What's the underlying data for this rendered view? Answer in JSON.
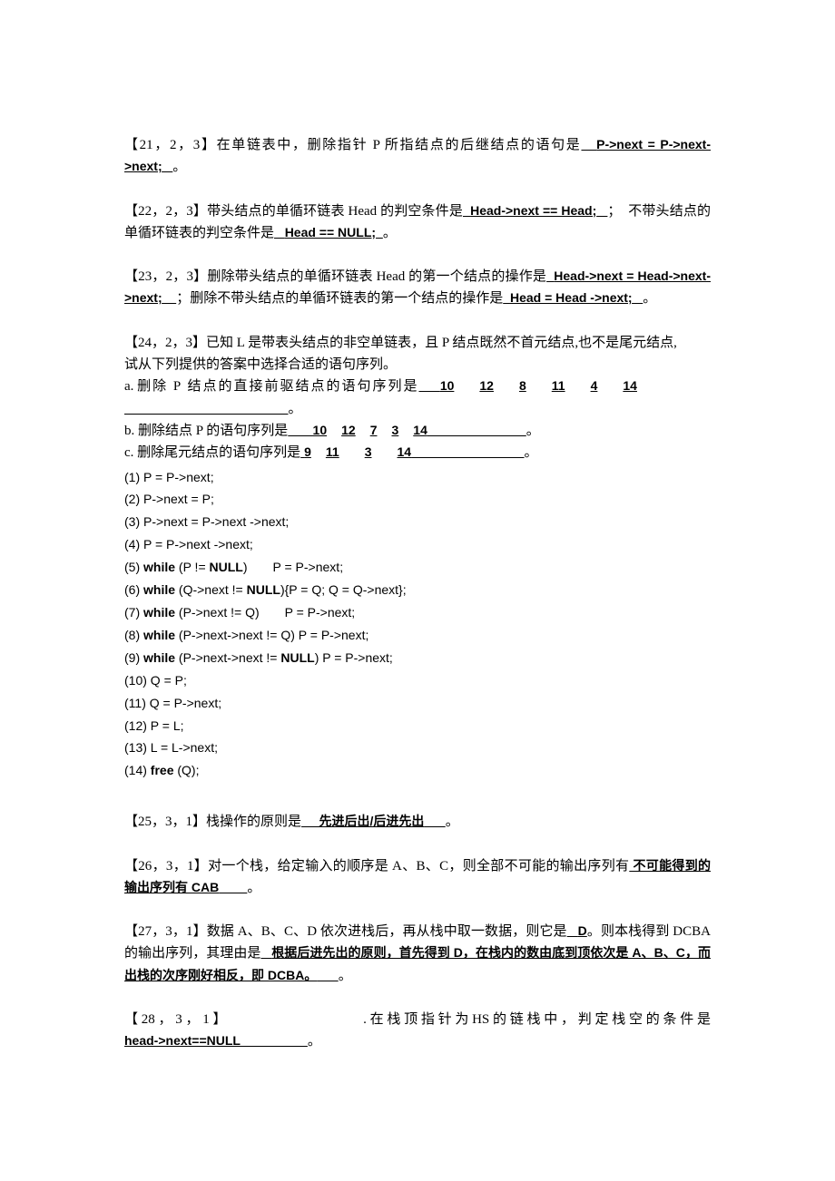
{
  "document": {
    "type": "exam-fill-in-the-blank",
    "language": "zh-CN"
  },
  "questions": [
    {
      "id": "q21",
      "tag": "【21，2，3】",
      "body_1": "在单链表中，删除指针 P 所指结点的后继结点的语句是",
      "answer_1": "P->next = P->next->next;",
      "trailer": "。"
    },
    {
      "id": "q22",
      "tag": "【22，2，3】",
      "body_1": "带头结点的单循环链表 Head 的判空条件是",
      "answer_1": "Head->next == Head;",
      "body_2": "；　不带头结点的单循环链表的判空条件是",
      "answer_2": "Head == NULL;",
      "trailer": "。"
    },
    {
      "id": "q23",
      "tag": "【23，2，3】",
      "body_1": "删除带头结点的单循环链表 Head 的第一个结点的操作是",
      "answer_1": "Head->next = Head->next->next;",
      "body_2": "；删除不带头结点的单循环链表的第一个结点的操作是",
      "answer_2": "Head = Head ->next;",
      "trailer": "。"
    }
  ],
  "q24": {
    "tag": "【24，2，3】",
    "head_line1": "已知 L 是带表头结点的非空单链表，且 P 结点既然不首元结点,也不是尾元结点,",
    "head_line2": "试从下列提供的答案中选择合适的语句序列。",
    "items": [
      {
        "label": "a.",
        "prompt": "删除 P 结点的直接前驱结点的语句序列是",
        "answer_numbers": [
          "10",
          "12",
          "8",
          "11",
          "4",
          "14"
        ],
        "trailer": "。"
      },
      {
        "label": "b.",
        "prompt": "删除结点 P 的语句序列是",
        "answer_numbers": [
          "10",
          "12",
          "7",
          "3",
          "14"
        ],
        "trailer": "。"
      },
      {
        "label": "c.",
        "prompt": "删除尾元结点的语句序列是",
        "answer_numbers": [
          "9",
          "11",
          "3",
          "14"
        ],
        "trailer": "。"
      }
    ],
    "statements": [
      {
        "num": "(1)",
        "text": "P = P->next;"
      },
      {
        "num": "(2)",
        "text": "P->next = P;"
      },
      {
        "num": "(3)",
        "text": "P->next = P->next ->next;"
      },
      {
        "num": "(4)",
        "text": "P = P->next ->next;"
      },
      {
        "num": "(5)",
        "kw": "while",
        "text": " (P != ",
        "kw2": "NULL",
        "text2": ")",
        "tail": "P = P->next;"
      },
      {
        "num": "(6)",
        "kw": "while",
        "text": " (Q->next != ",
        "kw2": "NULL",
        "text2": "){P = Q; Q = Q->next};"
      },
      {
        "num": "(7)",
        "kw": "while",
        "text": " (P->next != Q)",
        "tail2": "P = P->next;"
      },
      {
        "num": "(8)",
        "kw": "while",
        "text": " (P->next->next != Q) P = P->next;"
      },
      {
        "num": "(9)",
        "kw": "while",
        "text": " (P->next->next != ",
        "kw2": "NULL",
        "text2": ") P = P->next;"
      },
      {
        "num": "(10)",
        "text": "Q = P;"
      },
      {
        "num": "(11)",
        "text": "Q = P->next;"
      },
      {
        "num": "(12)",
        "text": "P = L;"
      },
      {
        "num": "(13)",
        "text": "L = L->next;"
      },
      {
        "num": "(14)",
        "kw": "free",
        "text": " (Q);"
      }
    ]
  },
  "questions_2": [
    {
      "id": "q25",
      "tag": "【25，3，1】",
      "body_1": "栈操作的原则是",
      "answer_1": "先进后出/后进先出",
      "trailer": "。"
    },
    {
      "id": "q26",
      "tag": "【26，3，1】",
      "body_1": "对一个栈，给定输入的顺序是 A、B、C，则全部不可能的输出序列有",
      "answer_1": "不可能得到的输出序列有 CAB",
      "trailer": "。"
    },
    {
      "id": "q27",
      "tag": "【27，3，1】",
      "body_1": "数据 A、B、C、D 依次进栈后，再从栈中取一数据，则它是",
      "answer_1": "D",
      "body_2": "。则本栈得到 DCBA 的输出序列，其理由是",
      "answer_2": "根据后进先出的原则，首先得到 D，在栈内的数由底到顶依次是 A、B、C，而出栈的次序刚好相反，即 DCBA。",
      "trailer": "。"
    },
    {
      "id": "q28",
      "tag": "【 28 ， 3 ， 1 】",
      "body_1": ". 在 栈 顶 指 针 为 HS 的 链 栈 中 ， 判 定 栈 空 的 条 件 是",
      "answer_1": "head->next==NULL",
      "trailer": "。"
    }
  ]
}
